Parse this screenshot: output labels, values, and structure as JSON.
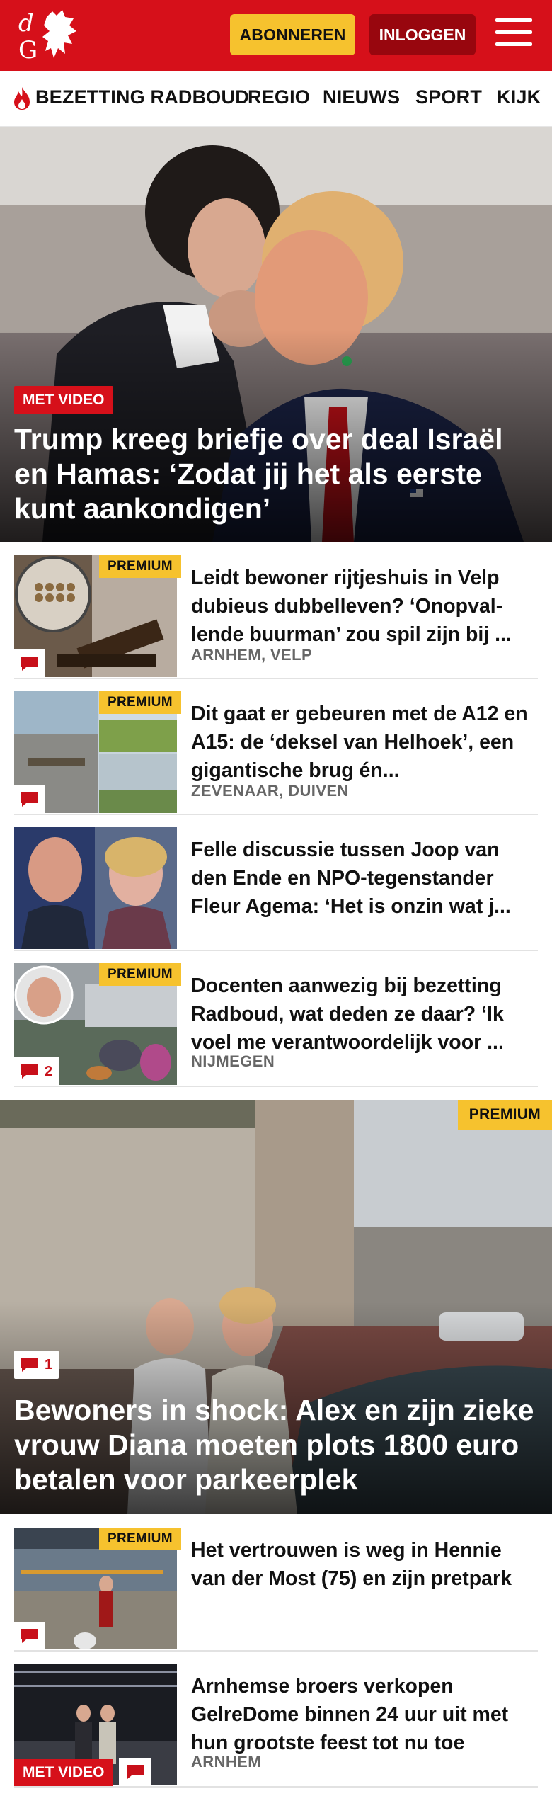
{
  "header": {
    "subscribe_label": "ABONNEREN",
    "login_label": "INLOGGEN",
    "brand_color": "#d6101a"
  },
  "nav": {
    "items": [
      {
        "label": "BEZETTING RADBOUD",
        "icon": "flame-icon"
      },
      {
        "label": "REGIO"
      },
      {
        "label": "NIEUWS"
      },
      {
        "label": "SPORT"
      },
      {
        "label": "KIJK"
      }
    ]
  },
  "hero": {
    "badge": "MET VIDEO",
    "title": "Trump kreeg briefje over deal Israël en Hamas: ‘Zodat jij het als eerste kunt aankondigen’"
  },
  "articles": [
    {
      "premium": "PREMIUM",
      "title": "Leidt bewoner rijtjeshuis in Velp dubieus dubbelleven? ‘Onopval-lende buurman’ zou spil zijn bij ...",
      "location": "ARNHEM, VELP",
      "comments": ""
    },
    {
      "premium": "PREMIUM",
      "title": "Dit gaat er gebeuren met de A12 en A15: de ‘deksel van Helhoek’, een gigantische brug én...",
      "location": "ZEVENAAR, DUIVEN",
      "comments": ""
    },
    {
      "premium": "",
      "title": "Felle discussie tussen Joop van den Ende en NPO-tegenstander Fleur Agema: ‘Het is onzin wat j...",
      "location": "",
      "comments": ""
    },
    {
      "premium": "PREMIUM",
      "title": "Docenten aanwezig bij bezetting Radboud, wat deden ze daar? ‘Ik voel me verantwoordelijk voor ...",
      "location": "NIJMEGEN",
      "comments": "2"
    }
  ],
  "feature": {
    "premium": "PREMIUM",
    "comments": "1",
    "title": "Bewoners in shock: Alex en zijn zieke vrouw Diana moeten plots 1800 euro betalen voor parkeerplek"
  },
  "articles2": [
    {
      "premium": "PREMIUM",
      "title": "Het vertrouwen is weg in Hennie van der Most (75) en zijn pretpark",
      "location": "",
      "comments": ""
    },
    {
      "badge": "MET VIDEO",
      "title": "Arnhemse broers verkopen GelreDome binnen 24 uur uit met hun grootste feest tot nu toe",
      "location": "ARNHEM",
      "comments": ""
    }
  ]
}
